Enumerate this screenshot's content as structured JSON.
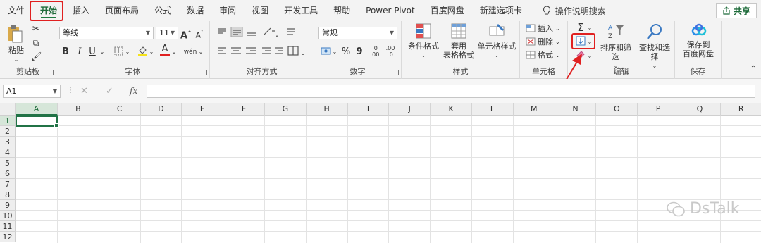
{
  "tabs": [
    "文件",
    "开始",
    "插入",
    "页面布局",
    "公式",
    "数据",
    "审阅",
    "视图",
    "开发工具",
    "帮助",
    "Power Pivot",
    "百度网盘",
    "新建选项卡"
  ],
  "tell_me": "操作说明搜索",
  "share": "共享",
  "ribbon": {
    "clipboard": {
      "paste": "粘贴",
      "label": "剪贴板"
    },
    "font": {
      "name": "等线",
      "size": "11",
      "label": "字体",
      "bold": "B",
      "italic": "I",
      "underline": "U",
      "grow": "A",
      "shrink": "A",
      "font_color": "A",
      "wen": "wén"
    },
    "alignment": {
      "label": "对齐方式"
    },
    "number": {
      "format": "常规",
      "label": "数字",
      "percent": "%",
      "comma": "9",
      "inc": ".00",
      "dec": ".0"
    },
    "styles": {
      "cond": "条件格式",
      "table_l1": "套用",
      "table_l2": "表格格式",
      "cell": "单元格样式",
      "label": "样式"
    },
    "cells": {
      "insert": "插入",
      "delete": "删除",
      "format": "格式",
      "label": "单元格"
    },
    "editing": {
      "sort": "排序和筛选",
      "find": "查找和选择",
      "label": "编辑"
    },
    "save": {
      "l1": "保存到",
      "l2": "百度网盘",
      "label": "保存"
    }
  },
  "formula_bar": {
    "name_box": "A1",
    "fx": "fx",
    "formula": ""
  },
  "columns": [
    "A",
    "B",
    "C",
    "D",
    "E",
    "F",
    "G",
    "H",
    "I",
    "J",
    "K",
    "L",
    "M",
    "N",
    "O",
    "P",
    "Q",
    "R"
  ],
  "rows": [
    "1",
    "2",
    "3",
    "4",
    "5",
    "6",
    "7",
    "8",
    "9",
    "10",
    "11",
    "12"
  ],
  "watermark": "DsTalk",
  "colors": {
    "accent": "#217346",
    "highlight": "#e02020",
    "ribbon_bg": "#f3f3f3"
  }
}
